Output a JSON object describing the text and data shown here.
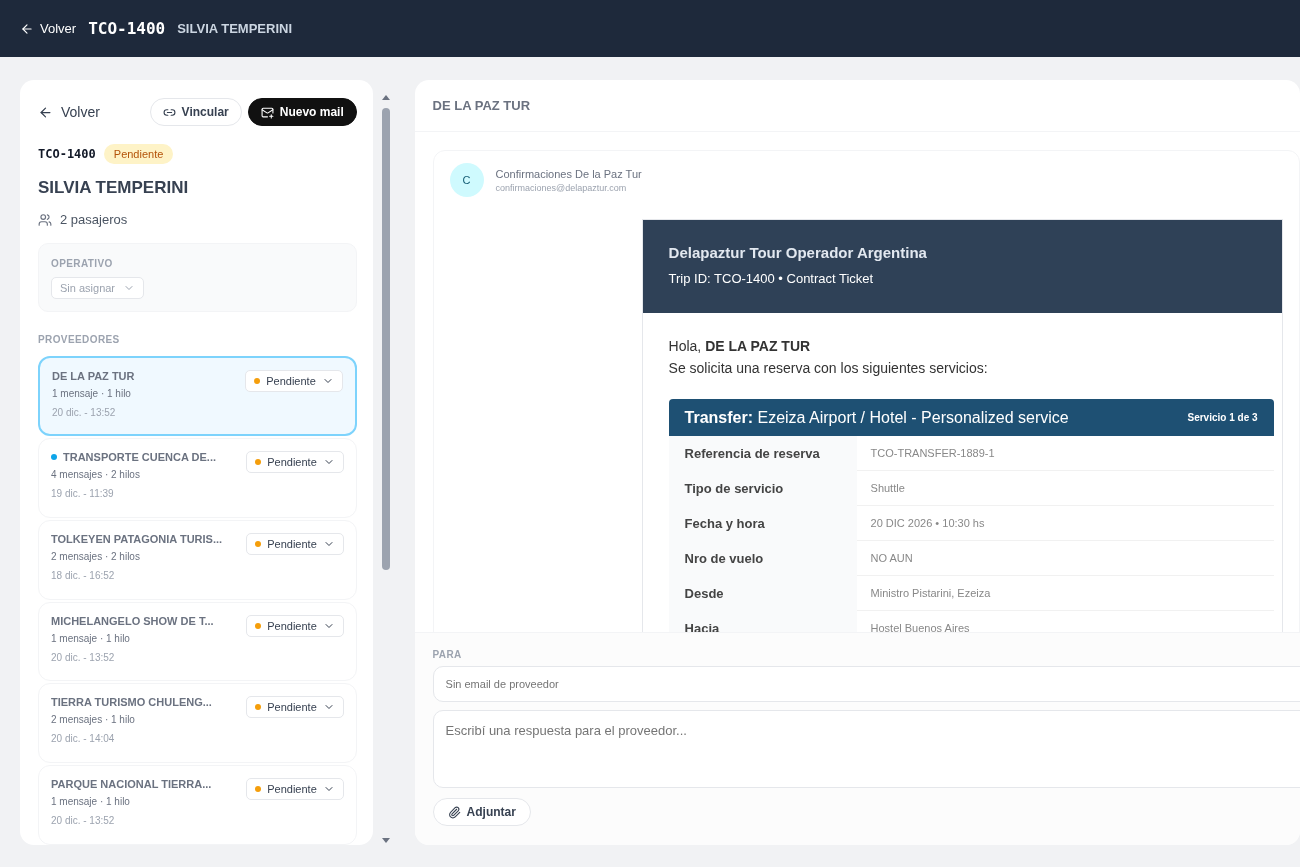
{
  "topbar": {
    "back": "Volver",
    "code": "TCO-1400",
    "name": "SILVIA TEMPERINI"
  },
  "sidebar": {
    "back": "Volver",
    "actions": [
      {
        "label": "Vincular",
        "kind": "outline"
      },
      {
        "label": "Nuevo mail",
        "kind": "solid"
      }
    ],
    "code": "TCO-1400",
    "status": "Pendiente",
    "name": "SILVIA TEMPERINI",
    "passengers": "2 pasajeros",
    "operativo": {
      "label": "OPERATIVO",
      "value": "Sin asignar"
    },
    "providers_label": "PROVEEDORES",
    "providers": [
      {
        "name": "DE LA PAZ TUR",
        "meta": "1 mensaje · 1 hilo",
        "date": "20 dic.",
        "time": "- 13:52",
        "status": "Pendiente",
        "selected": true,
        "unread": false
      },
      {
        "name": "TRANSPORTE CUENCA DE...",
        "meta": "4 mensajes · 2 hilos",
        "date": "19 dic.",
        "time": "- 11:39",
        "status": "Pendiente",
        "selected": false,
        "unread": true
      },
      {
        "name": "TOLKEYEN PATAGONIA TURIS...",
        "meta": "2 mensajes · 2 hilos",
        "date": "18 dic.",
        "time": "- 16:52",
        "status": "Pendiente",
        "selected": false,
        "unread": false
      },
      {
        "name": "MICHELANGELO SHOW DE T...",
        "meta": "1 mensaje · 1 hilo",
        "date": "20 dic.",
        "time": "- 13:52",
        "status": "Pendiente",
        "selected": false,
        "unread": false
      },
      {
        "name": "TIERRA TURISMO CHULENG...",
        "meta": "2 mensajes · 1 hilo",
        "date": "20 dic.",
        "time": "- 14:04",
        "status": "Pendiente",
        "selected": false,
        "unread": false
      },
      {
        "name": "PARQUE NACIONAL TIERRA...",
        "meta": "1 mensaje · 1 hilo",
        "date": "20 dic.",
        "time": "- 13:52",
        "status": "Pendiente",
        "selected": false,
        "unread": false
      }
    ]
  },
  "thread": {
    "title": "DE LA PAZ TUR",
    "message": {
      "avatar": "C",
      "sender": "Confirmaciones De la Paz Tur",
      "email": "confirmaciones@delapaztur.com",
      "banner_title": "Delapaztur Tour Operador Argentina",
      "banner_subtitle": "Trip ID: TCO-1400 • Contract Ticket",
      "greeting": "Hola, **DE LA PAZ TUR**",
      "intro": "Se solicita una reserva con los siguientes servicios:",
      "service": {
        "title": "**Transfer:** Ezeiza Airport / Hotel - Personalized service",
        "counter": "Servicio 1 de 3",
        "rows": [
          {
            "label": "Referencia de reserva",
            "value": "TCO-TRANSFER-1889-1"
          },
          {
            "label": "Tipo de servicio",
            "value": "Shuttle"
          },
          {
            "label": "Fecha y hora",
            "value": "20 DIC 2026 • 10:30 hs"
          },
          {
            "label": "Nro de vuelo",
            "value": "NO AUN"
          },
          {
            "label": "Desde",
            "value": "Ministro Pistarini, Ezeiza"
          },
          {
            "label": "Hacia",
            "value": "Hostel Buenos Aires"
          }
        ]
      }
    }
  },
  "composer": {
    "to_label": "PARA",
    "to_placeholder": "Sin email de proveedor",
    "body_placeholder": "Escribí una respuesta para el proveedor...",
    "attach": "Adjuntar"
  }
}
